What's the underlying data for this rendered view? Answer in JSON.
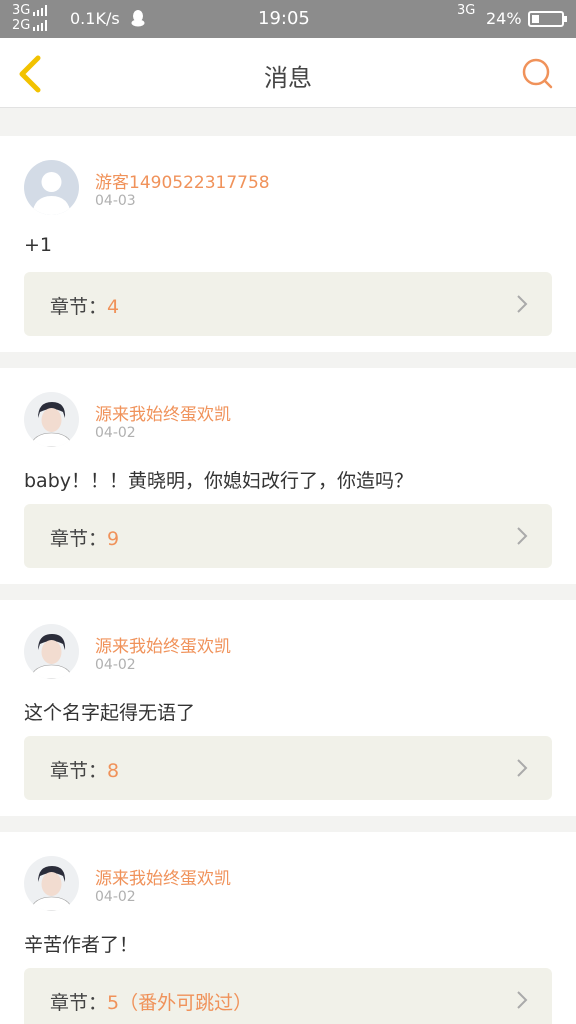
{
  "status_bar": {
    "net_top": "3G",
    "net_bottom": "2G",
    "speed": "0.1K/s",
    "time": "19:05",
    "network_right": "3G",
    "battery": "24%",
    "battery_level": 0.24
  },
  "header": {
    "title": "消息",
    "back_icon": "chevron-left-icon",
    "search_icon": "search-icon",
    "accent_color": "#f0925a",
    "back_color": "#f2c200"
  },
  "messages": [
    {
      "avatar": "default-user-avatar",
      "name": "游客1490522317758",
      "date": "04-03",
      "text": "+1",
      "chapter_label": "章节：",
      "chapter_value": "4"
    },
    {
      "avatar": "user-photo-avatar",
      "name": "源来我始终蛋欢凯",
      "date": "04-02",
      "text": "baby！！！黄晓明，你媳妇改行了，你造吗？",
      "chapter_label": "章节：",
      "chapter_value": "9"
    },
    {
      "avatar": "user-photo-avatar",
      "name": "源来我始终蛋欢凯",
      "date": "04-02",
      "text": "这个名字起得无语了",
      "chapter_label": "章节：",
      "chapter_value": "8"
    },
    {
      "avatar": "user-photo-avatar",
      "name": "源来我始终蛋欢凯",
      "date": "04-02",
      "text": "辛苦作者了！",
      "chapter_label": "章节：",
      "chapter_value": "5（番外可跳过）"
    }
  ]
}
